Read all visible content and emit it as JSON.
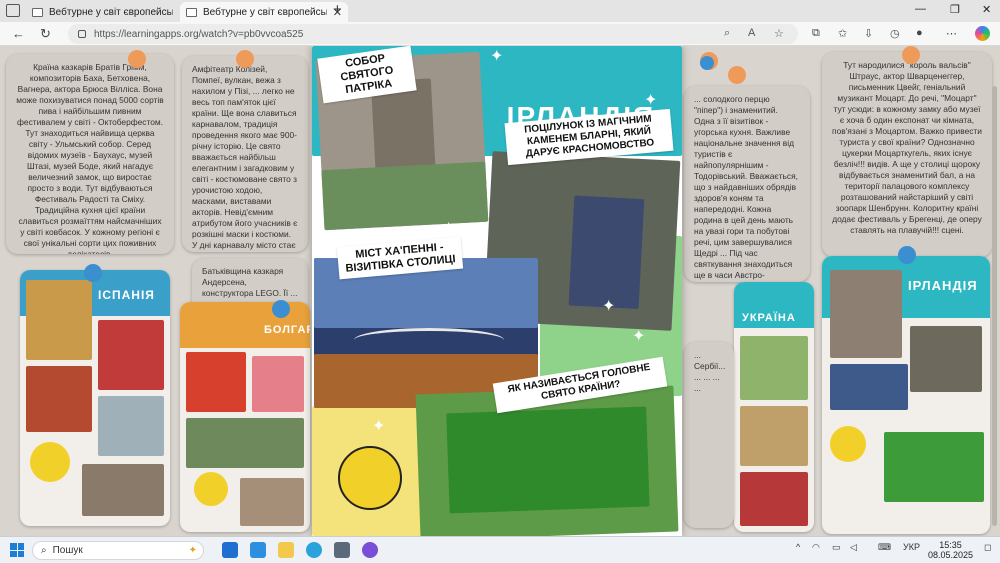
{
  "browser": {
    "tabs": [
      {
        "title": "Вебтурне у світ європейських кухонь",
        "active": false
      },
      {
        "title": "Вебтурне у світ європейських кухонь",
        "active": true
      }
    ],
    "url": "https://learningapps.org/watch?v=pb0vvcoa525"
  },
  "cards": {
    "germany": "Країна казкарів Братів Грімм, композиторів Баха, Бетховена, Вагнера, актора Брюса Вілліса. Вона може похизуватися понад 5000 сортів пива і найбільшим пивним фестивалем у світі - Октоберфестом. Тут знаходиться найвища церква світу - Ульмський собор. Серед відомих музеїв - Баухаус, музей Штазі, музей Боде, який нагадує величезний замок, що виростає просто з води. Тут відбуваються Фестиваль Радості та Сміху. Традиційна кухня цієї країни славиться розмаїттям найсмачніших у світі ковбасок. У кожному регіоні є свої унікальні сорти цих поживних делікатесів.",
    "italy": "Амфітеатр Колізей, Помпеї, вулкан, вежа з нахилом у Пізі, ... легко не весь топ пам'яток цієї країни. Ще вона славиться карнавалом, традиція проведення якого має 900-річну історію. Це свято вважається найбільш елегантним і загадковим у світі - костюмоване свято з урочистою ходою, масками, виставами акторів. Невід'ємним атрибутом його учасників є розкішні маски і костюми. У дні карнавалу місто стає суцільною театральною сценою, на якій одночасно акторами і глядачами. Країна відома рекордною кількістю видів макаронів.",
    "denmark": "Батьківщина казкаря Андерсена, конструктора LEGO. Її ... ними символами стали ка...",
    "hungary": "... солодкого перцю \"піпер\") і знаменитий. Одна з її візитівок - угорська кухня. Важливе національне значення від туристів є найпопулярнішим - Тодорівський. Вважається, що з найдавніших обрядів здоров'я коням та напередодні. Кожна родина в цей день мають на увазі гори та побутові речі, цим завершувалися Щедрі ... Під час святкування знаходиться ще в часи Австро-Угорської імперії.",
    "austria": "Тут народилися \"король вальсів\" Штраус, актор Шварценеггер, письменник Цвейг, геніальний музикант Моцарт. До речі, \"Моцарт\" тут усюди: в кожному замку або музеї є хоча б один експонат чи кімната, пов'язані з Моцартом. Важко привести туриста у свої країни? Однозначно цукерки Моцарткугель, яких існує безліч!!! видів. А ще у столиці щороку відбувається знаменитий бал, а на території палацового комплексу розташований найстаріший у світі зоопарк Шенбрунн. Колоритну країні додає фестиваль у Брегенці, де оперу ставлять на плавучій!!! сцені.",
    "truncated_bottom": "... ще т...",
    "serbia": "... Сербії... ... ... ... ...",
    "spain_title": "ІСПАНІЯ",
    "bulgaria_title": "БОЛГАРІЯ",
    "ukraine_title": "УКРАЇНА",
    "ireland_thumb_title": "ІРЛАНДІЯ"
  },
  "poster": {
    "title": "ІРЛАНДІЯ",
    "captions": {
      "cathedral": "Собор Святого Патріка",
      "blarney": "Поцілунок із магічним каменем Бларні, який дарує красномовство",
      "bridge": "Міст Ха'Пенні - візитівка столиці",
      "holiday": "Як називається головне свято країни?"
    }
  },
  "taskbar": {
    "search_label": "Пошук",
    "language": "УКР",
    "time": "15:35",
    "date": "08.05.2025"
  },
  "colors": {
    "poster_teal": "#2cb7c2",
    "poster_green": "#8fd38a",
    "pin_orange": "#ee9b5a",
    "pin_blue": "#3b8fd0"
  }
}
